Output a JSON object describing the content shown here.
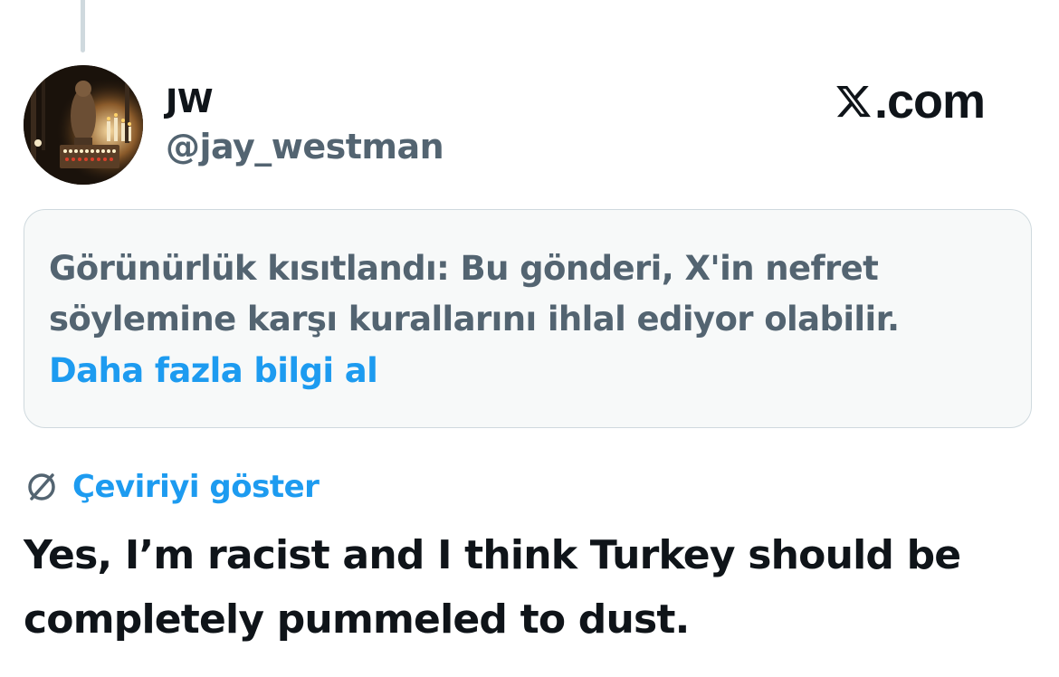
{
  "tweet": {
    "author": {
      "display_name": "JW",
      "handle": "@jay_westman",
      "avatar_icon": "avatar-candles-image"
    },
    "brand": {
      "text": ".com",
      "logo_icon": "x-logo-icon"
    },
    "notice": {
      "text": "Görünürlük kısıtlandı: Bu gönderi, X'in nefret söylemine karşı kurallarını ihlal ediyor olabilir.",
      "link": "Daha fazla bilgi al"
    },
    "translate": {
      "icon": "globe-icon",
      "label": "Çeviriyi göster"
    },
    "text": "Yes, I’m racist and I think Turkey should be completely pummeled to dust."
  },
  "colors": {
    "primary_text": "#0f1419",
    "secondary_text": "#536471",
    "link": "#1d9bf0",
    "notice_bg": "#f7f9f9",
    "border": "#cfd9de"
  }
}
